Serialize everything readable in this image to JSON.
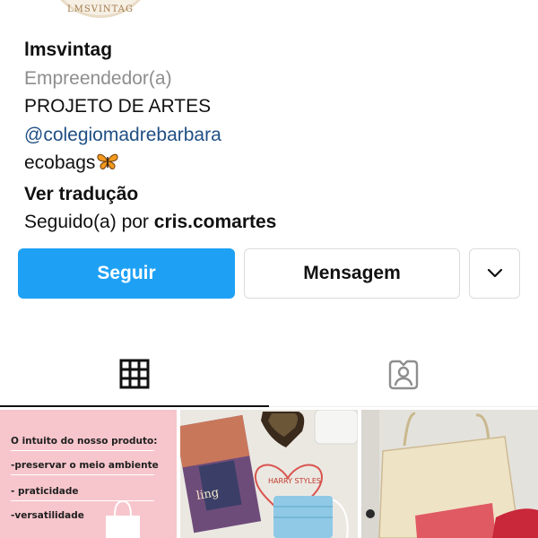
{
  "profile": {
    "avatar_text": "LMSVINTAG",
    "username": "lmsvintag",
    "category": "Empreendedor(a)",
    "bio_line1": "PROJETO DE ARTES",
    "mention": "@colegiomadrebarbara",
    "bio_line3": "ecobags",
    "translate_link": "Ver tradução",
    "followed_prefix": "Seguido(a) por ",
    "followed_name": "cris.comartes"
  },
  "actions": {
    "follow_label": "Seguir",
    "message_label": "Mensagem"
  },
  "colors": {
    "follow_button": "#1ea1f5",
    "mention": "#1f4f84",
    "category": "#8e8e8e",
    "post1_background": "#f7c6cc"
  },
  "tabs": [
    {
      "icon": "grid-icon",
      "active": true
    },
    {
      "icon": "tagged-icon",
      "active": false
    }
  ],
  "posts": {
    "post1": {
      "title": "O intuito do nosso produto:",
      "items": [
        "-preservar o meio ambiente",
        "- praticidade",
        "-versatilidade"
      ]
    },
    "post2": {
      "book_text": "ling",
      "heart_text": "HARRY STYLES"
    }
  }
}
